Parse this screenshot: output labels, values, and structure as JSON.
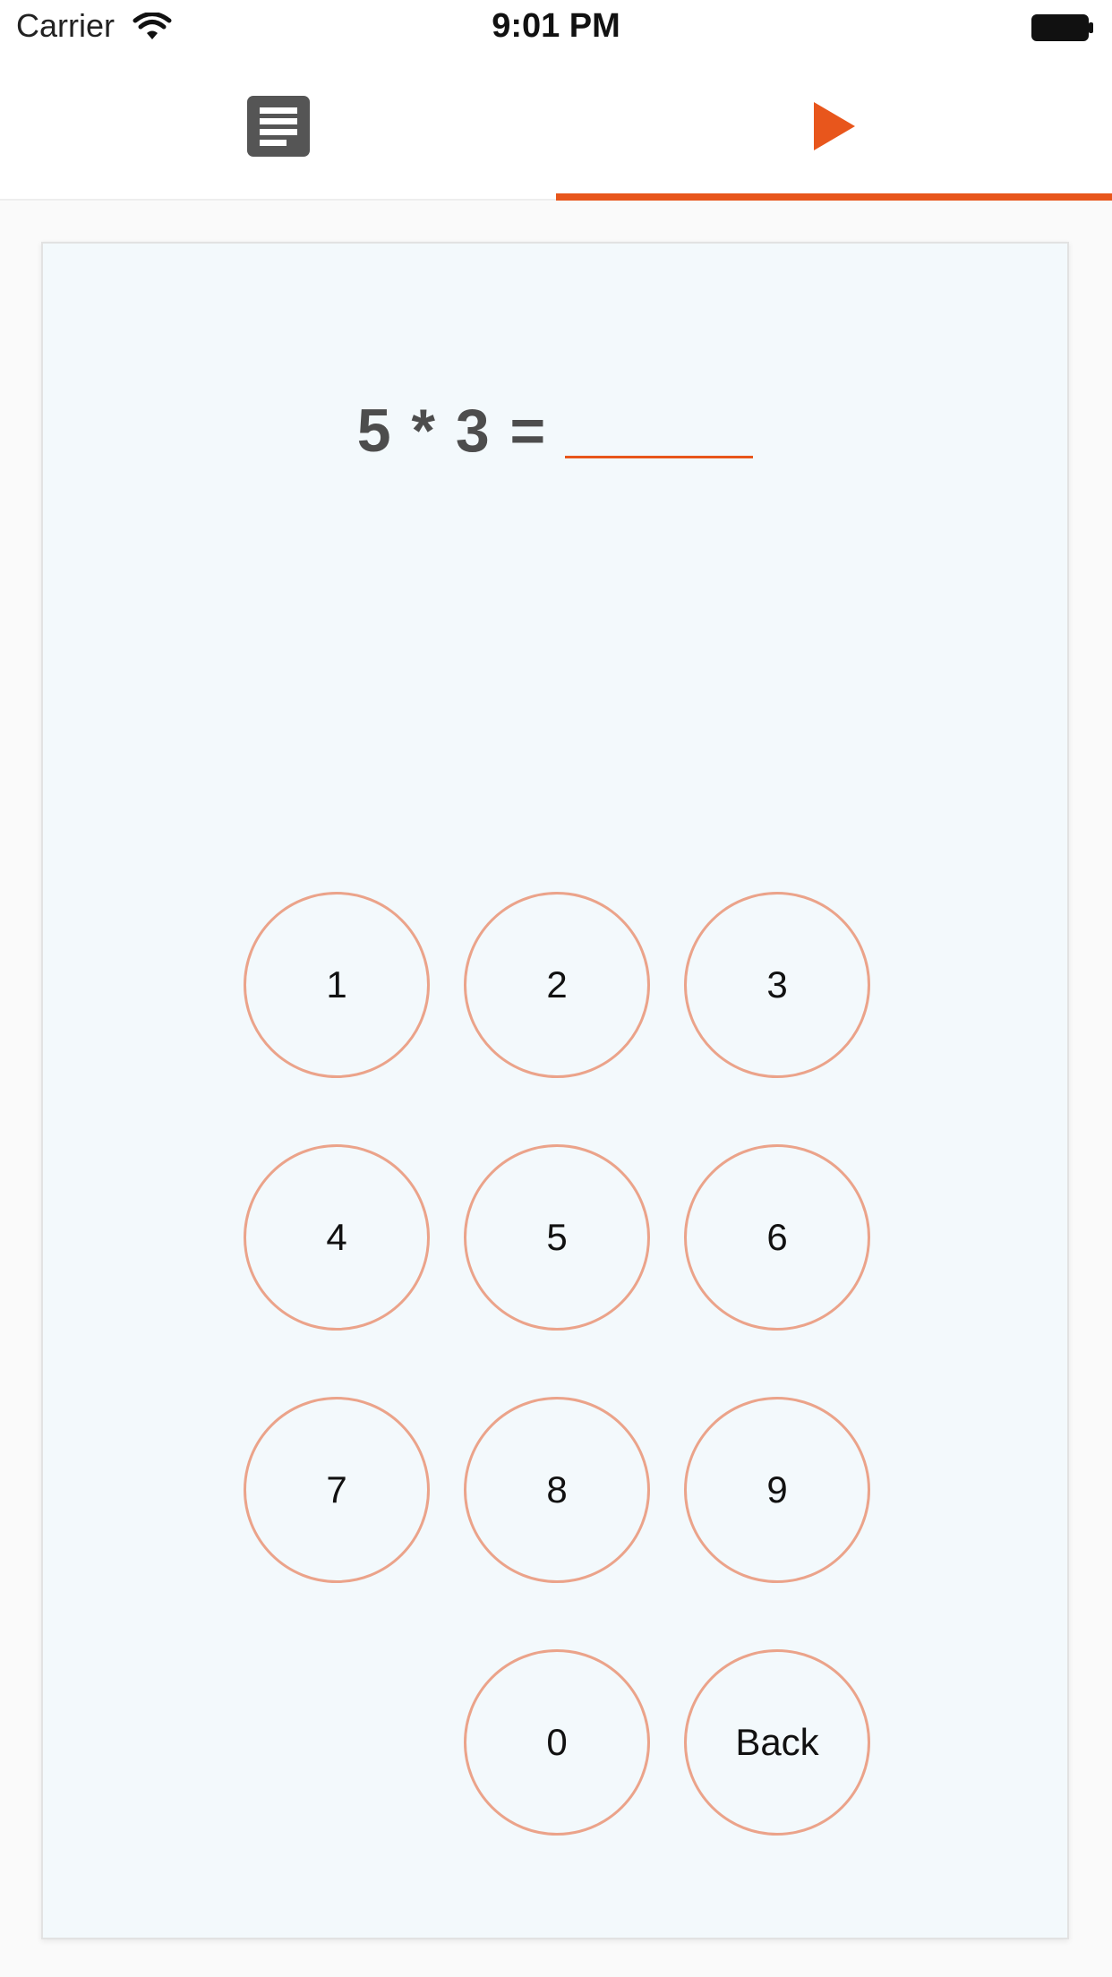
{
  "status_bar": {
    "carrier": "Carrier",
    "time": "9:01 PM"
  },
  "tabs": [
    {
      "icon": "document-icon",
      "active": false
    },
    {
      "icon": "play-icon",
      "active": true
    }
  ],
  "question": {
    "expression": "5 * 3 =",
    "answer": ""
  },
  "keypad": {
    "k1": "1",
    "k2": "2",
    "k3": "3",
    "k4": "4",
    "k5": "5",
    "k6": "6",
    "k7": "7",
    "k8": "8",
    "k9": "9",
    "k0": "0",
    "back": "Back"
  },
  "colors": {
    "accent": "#e8561c",
    "key_border": "#eba38a",
    "card_bg": "#f3f9fc",
    "icon_gray": "#4d4d4d"
  }
}
